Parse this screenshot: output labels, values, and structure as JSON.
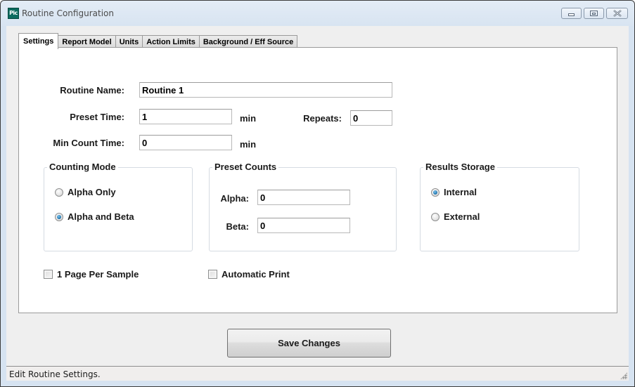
{
  "window": {
    "title": "Routine Configuration",
    "app_icon_text": "Pic",
    "controls": {
      "minimize": "minimize-icon",
      "maximize": "maximize-icon",
      "close": "close-icon"
    }
  },
  "tabs": [
    {
      "label": "Settings",
      "active": true
    },
    {
      "label": "Report Model",
      "active": false
    },
    {
      "label": "Units",
      "active": false
    },
    {
      "label": "Action Limits",
      "active": false
    },
    {
      "label": "Background / Eff Source",
      "active": false
    }
  ],
  "settings": {
    "routine_name": {
      "label": "Routine Name:",
      "value": "Routine 1"
    },
    "preset_time": {
      "label": "Preset Time:",
      "value": "1",
      "unit": "min"
    },
    "repeats": {
      "label": "Repeats:",
      "value": "0"
    },
    "min_count_time": {
      "label": "Min Count Time:",
      "value": "0",
      "unit": "min"
    },
    "counting_mode": {
      "title": "Counting Mode",
      "options": [
        {
          "label": "Alpha Only",
          "checked": false
        },
        {
          "label": "Alpha and Beta",
          "checked": true
        }
      ]
    },
    "preset_counts": {
      "title": "Preset Counts",
      "alpha": {
        "label": "Alpha:",
        "value": "0"
      },
      "beta": {
        "label": "Beta:",
        "value": "0"
      }
    },
    "results_storage": {
      "title": "Results Storage",
      "options": [
        {
          "label": "Internal",
          "checked": true
        },
        {
          "label": "External",
          "checked": false
        }
      ]
    },
    "one_page_per_sample": {
      "label": "1 Page Per Sample",
      "checked": false
    },
    "automatic_print": {
      "label": "Automatic Print",
      "checked": false
    }
  },
  "buttons": {
    "save": "Save Changes"
  },
  "status": {
    "text": "Edit Routine Settings."
  }
}
